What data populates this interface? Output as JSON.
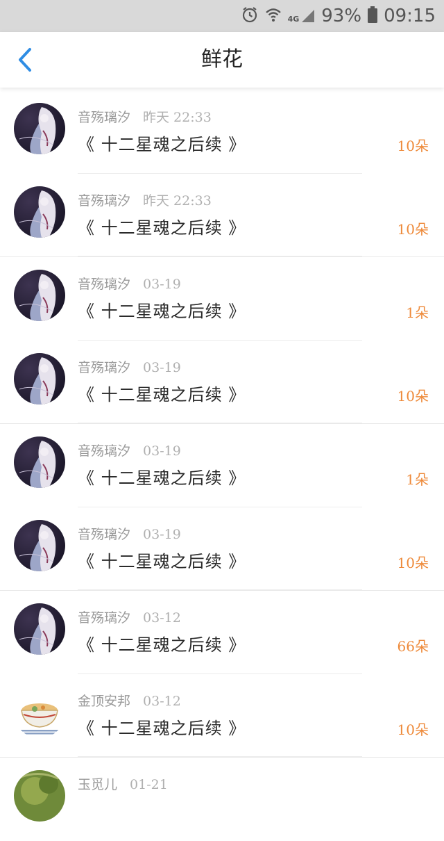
{
  "status": {
    "battery": "93%",
    "time": "09:15",
    "network": "4G"
  },
  "nav": {
    "title": "鲜花"
  },
  "items": [
    {
      "user": "音殇璃汐",
      "time": "昨天 22:33",
      "title": "《 十二星魂之后续 》",
      "count": "10朵",
      "avatar": "anime"
    },
    {
      "user": "音殇璃汐",
      "time": "昨天 22:33",
      "title": "《 十二星魂之后续 》",
      "count": "10朵",
      "avatar": "anime"
    },
    {
      "user": "音殇璃汐",
      "time": "03-19",
      "title": "《 十二星魂之后续 》",
      "count": "1朵",
      "avatar": "anime"
    },
    {
      "user": "音殇璃汐",
      "time": "03-19",
      "title": "《 十二星魂之后续 》",
      "count": "10朵",
      "avatar": "anime"
    },
    {
      "user": "音殇璃汐",
      "time": "03-19",
      "title": "《 十二星魂之后续 》",
      "count": "1朵",
      "avatar": "anime"
    },
    {
      "user": "音殇璃汐",
      "time": "03-19",
      "title": "《 十二星魂之后续 》",
      "count": "10朵",
      "avatar": "anime"
    },
    {
      "user": "音殇璃汐",
      "time": "03-12",
      "title": "《 十二星魂之后续 》",
      "count": "66朵",
      "avatar": "anime"
    },
    {
      "user": "金顶安邦",
      "time": "03-12",
      "title": "《 十二星魂之后续 》",
      "count": "10朵",
      "avatar": "bowl"
    },
    {
      "user": "玉觅儿",
      "time": "01-21",
      "title": "",
      "count": "",
      "avatar": "green"
    }
  ],
  "colors": {
    "accent": "#2f8de4",
    "count": "#ee8a3a",
    "status_bar": "#d9d9d9"
  }
}
